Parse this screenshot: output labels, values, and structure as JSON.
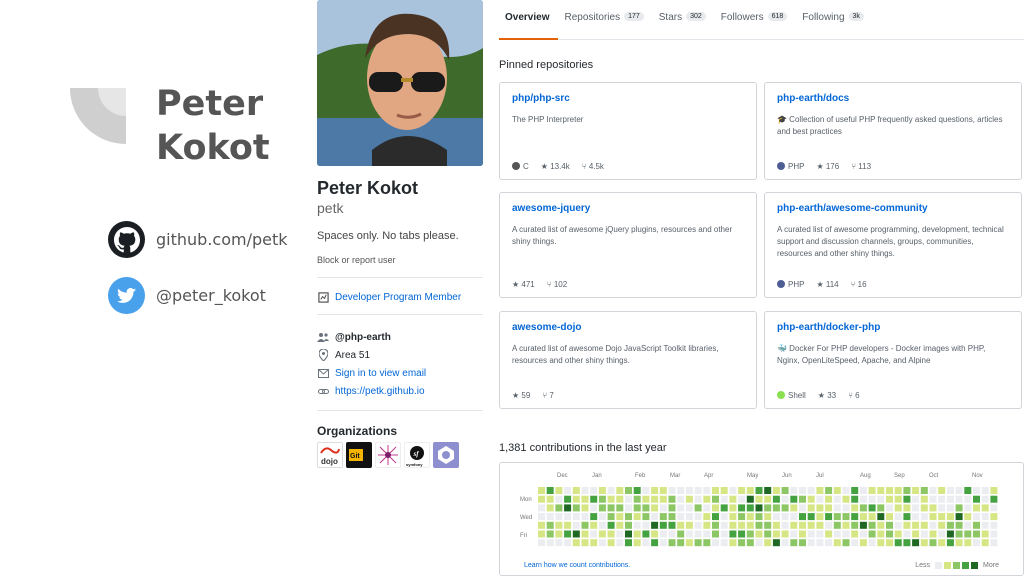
{
  "slide": {
    "title_line1": "Peter",
    "title_line2": "Kokot",
    "github_handle": "github.com/petk",
    "twitter_handle": "@peter_kokot"
  },
  "profile": {
    "name": "Peter Kokot",
    "login": "petk",
    "bio": "Spaces only. No tabs please.",
    "block_report": "Block or report user",
    "developer_badge": "Developer Program Member",
    "organization": "@php-earth",
    "location": "Area 51",
    "email_link": "Sign in to view email",
    "website": "https://petk.github.io",
    "organizations_title": "Organizations",
    "organizations": [
      "dojo",
      "Git",
      "php",
      "symfony",
      "github"
    ]
  },
  "tabs": [
    {
      "label": "Overview",
      "count": ""
    },
    {
      "label": "Repositories",
      "count": "177"
    },
    {
      "label": "Stars",
      "count": "302"
    },
    {
      "label": "Followers",
      "count": "618"
    },
    {
      "label": "Following",
      "count": "3k"
    }
  ],
  "pinned": {
    "title": "Pinned repositories",
    "repos": [
      {
        "name": "php/php-src",
        "desc": "The PHP Interpreter",
        "lang": "C",
        "lang_color": "#555555",
        "stars": "13.4k",
        "forks": "4.5k"
      },
      {
        "name": "php-earth/docs",
        "desc": "🎓 Collection of useful PHP frequently asked questions, articles and best practices",
        "lang": "PHP",
        "lang_color": "#4F5D95",
        "stars": "176",
        "forks": "113"
      },
      {
        "name": "awesome-jquery",
        "desc": "A curated list of awesome jQuery plugins, resources and other shiny things.",
        "lang": "",
        "lang_color": "",
        "stars": "471",
        "forks": "102"
      },
      {
        "name": "php-earth/awesome-community",
        "desc": "A curated list of awesome programming, development, technical support and discussion channels, groups, communities, resources and other shiny things.",
        "lang": "PHP",
        "lang_color": "#4F5D95",
        "stars": "114",
        "forks": "16"
      },
      {
        "name": "awesome-dojo",
        "desc": "A curated list of awesome Dojo JavaScript Toolkit libraries, resources and other shiny things.",
        "lang": "",
        "lang_color": "",
        "stars": "59",
        "forks": "7"
      },
      {
        "name": "php-earth/docker-php",
        "desc": "🐳 Docker For PHP developers - Docker images with PHP, Nginx, OpenLiteSpeed, Apache, and Alpine",
        "lang": "Shell",
        "lang_color": "#89e051",
        "stars": "33",
        "forks": "6"
      }
    ]
  },
  "contributions": {
    "title": "1,381 contributions in the last year",
    "months": [
      "Dec",
      "Jan",
      "Feb",
      "Mar",
      "Apr",
      "May",
      "Jun",
      "Jul",
      "Aug",
      "Sep",
      "Oct",
      "Nov"
    ],
    "day_labels": [
      "Mon",
      "Wed",
      "Fri"
    ],
    "learn_link": "Learn how we count contributions.",
    "legend_less": "Less",
    "legend_more": "More",
    "colors": [
      "#ebedf0",
      "#d6e685",
      "#8cc665",
      "#44a340",
      "#1e6823"
    ]
  }
}
